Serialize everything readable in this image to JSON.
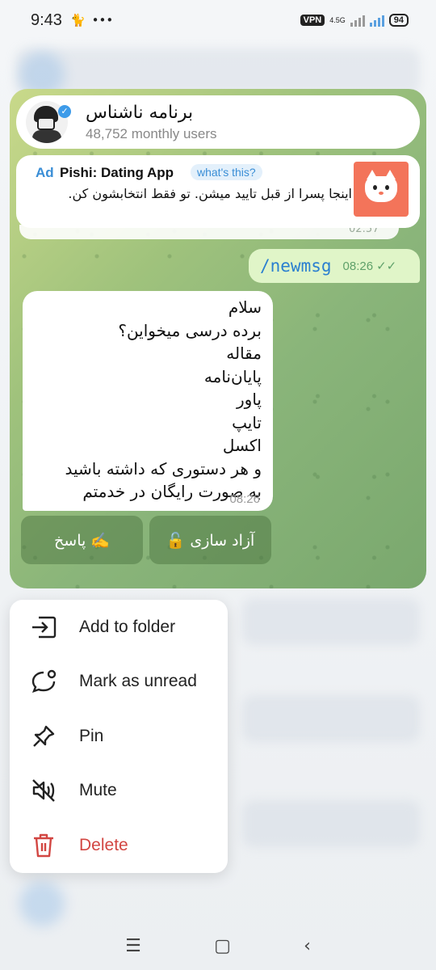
{
  "status": {
    "time": "9:43",
    "vpn": "VPN",
    "network": "4.5G",
    "battery": "94"
  },
  "chat": {
    "title": "برنامه ناشناس",
    "subtitle": "48,752 monthly users",
    "ad": {
      "label": "Ad",
      "name": "Pishi: Dating App",
      "whats_this": "what's this?",
      "text": "اینجا پسرا از قبل تایید میشن. تو فقط انتخابشون کن."
    },
    "prev_time": "02:57",
    "outgoing": {
      "text": "/newmsg",
      "time": "08:26"
    },
    "incoming": {
      "lines": [
        "سلام",
        "برده درسی میخواین؟",
        "مقاله",
        "پایان‌نامه",
        "پاور",
        "تایپ",
        "اکسل",
        "و هر دستوری که داشته باشید",
        "به صورت رایگان در خدمتم"
      ],
      "time": "08:26"
    },
    "keyboard": [
      "🔓 آزاد سازی",
      "پاسخ ✍️"
    ]
  },
  "menu": {
    "items": [
      {
        "label": "Add to folder",
        "icon": "folder-add-icon"
      },
      {
        "label": "Mark as unread",
        "icon": "chat-unread-icon"
      },
      {
        "label": "Pin",
        "icon": "pin-icon"
      },
      {
        "label": "Mute",
        "icon": "mute-icon"
      },
      {
        "label": "Delete",
        "icon": "trash-icon"
      }
    ]
  },
  "colors": {
    "accent": "#3a8ed6",
    "danger": "#d24642",
    "outgoing_bubble": "#e0f5c8"
  }
}
